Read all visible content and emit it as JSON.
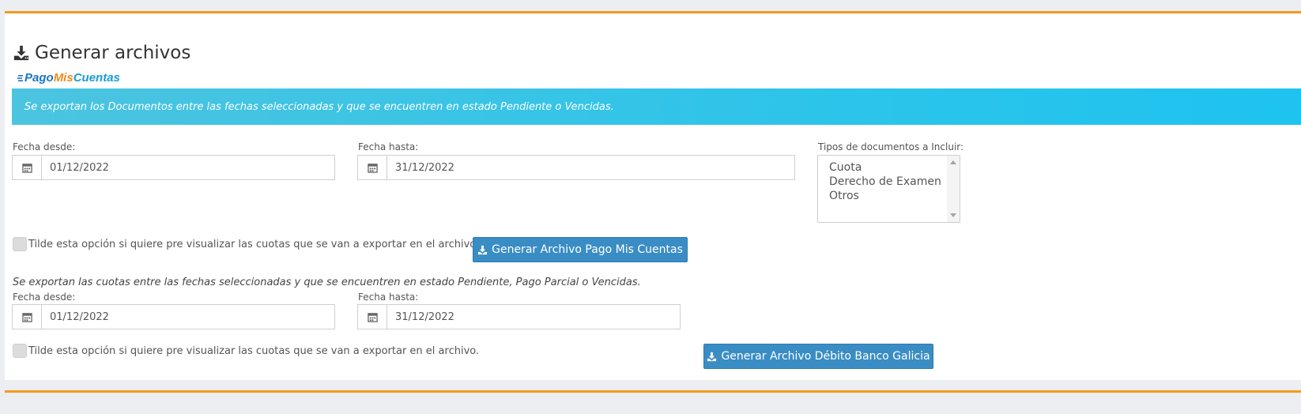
{
  "page": {
    "title": "Generar archivos",
    "title_icon": "download-icon",
    "accent_color": "#f39a1e"
  },
  "logo": {
    "part1": "Pago",
    "part2": "Mis",
    "part3": "Cuentas"
  },
  "pmc": {
    "info": "Se exportan los Documentos entre las fechas seleccionadas y que se encuentren en estado Pendiente o Vencidas.",
    "date_from": {
      "label": "Fecha desde:",
      "value": "01/12/2022",
      "icon": "calendar-icon"
    },
    "date_to": {
      "label": "Fecha hasta:",
      "value": "31/12/2022",
      "icon": "calendar-icon"
    },
    "doc_types": {
      "label": "Tipos de documentos a Incluir:",
      "options": [
        "Cuota",
        "Derecho de Examen",
        "Otros"
      ]
    },
    "preview_checkbox": "Tilde esta opción si quiere pre visualizar las cuotas que se van a exportar en el archivo.",
    "button": "Generar Archivo Pago Mis Cuentas"
  },
  "galicia": {
    "info": "Se exportan las cuotas entre las fechas seleccionadas y que se encuentren en estado Pendiente, Pago Parcial o Vencidas.",
    "date_from": {
      "label": "Fecha desde:",
      "value": "01/12/2022",
      "icon": "calendar-icon"
    },
    "date_to": {
      "label": "Fecha hasta:",
      "value": "31/12/2022",
      "icon": "calendar-icon"
    },
    "preview_checkbox": "Tilde esta opción si quiere pre visualizar las cuotas que se van a exportar en el archivo.",
    "button": "Generar Archivo Débito Banco Galicia"
  }
}
